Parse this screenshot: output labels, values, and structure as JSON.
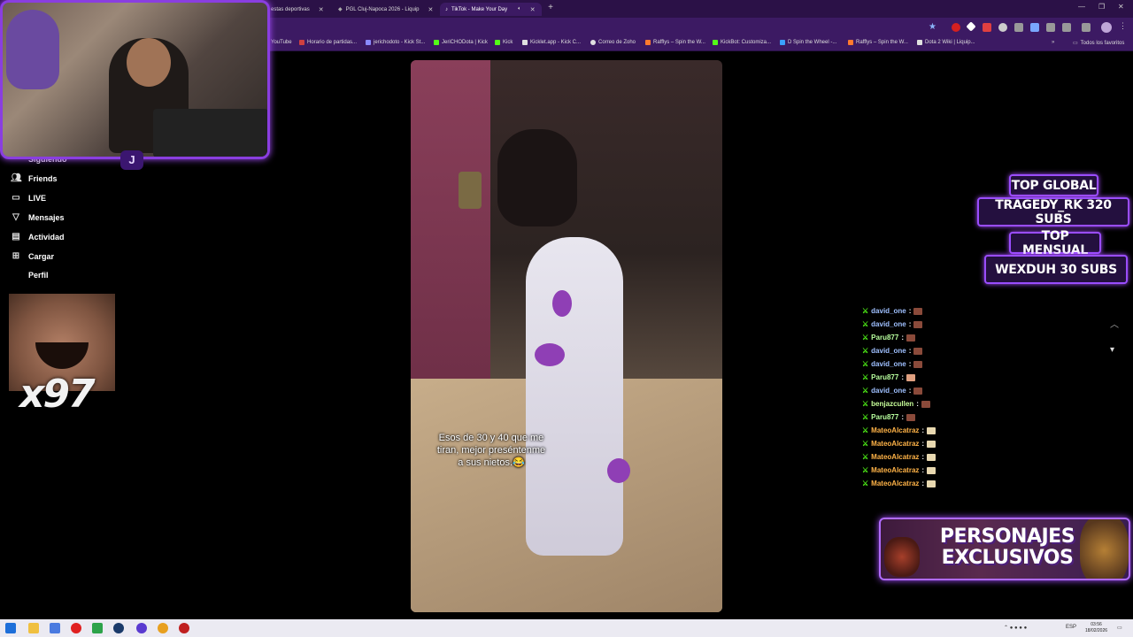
{
  "browser": {
    "tabs": [
      {
        "label": "estas deportivas",
        "active": false
      },
      {
        "label": "PGL Cluj-Napoca 2026 - Liquip",
        "active": false
      },
      {
        "label": "TikTok - Make Your Day",
        "active": true
      }
    ],
    "bookmarks": [
      {
        "label": "YouTube",
        "color": "#ff0000"
      },
      {
        "label": "Horario de partidas...",
        "color": "#d04040"
      },
      {
        "label": "jerichodoto - Kick St...",
        "color": "#8a8aff"
      },
      {
        "label": "JeriCHODota | Kick",
        "color": "#53fc18"
      },
      {
        "label": "Kick",
        "color": "#53fc18"
      },
      {
        "label": "Kicklet.app - Kick C...",
        "color": "#e0e0e0"
      },
      {
        "label": "Correo de Zoho",
        "color": "#e0e0e0"
      },
      {
        "label": "Rafflys – Spin the W...",
        "color": "#ff7a2e"
      },
      {
        "label": "KickBot: Customiza...",
        "color": "#53fc18"
      },
      {
        "label": "D Spin the Wheel -...",
        "color": "#3aa0ff"
      },
      {
        "label": "Rafflys – Spin the W...",
        "color": "#ff7a2e"
      },
      {
        "label": "Dota 2 Wiki | Liquip...",
        "color": "#e0e0e0"
      }
    ],
    "bookmarks_folder": "Todos los favoritos"
  },
  "sidebar": {
    "partial_top": "Siguiendo",
    "items": [
      {
        "label": "Friends",
        "icon": "friends-icon"
      },
      {
        "label": "LIVE",
        "icon": "live-icon"
      },
      {
        "label": "Mensajes",
        "icon": "messages-icon"
      },
      {
        "label": "Actividad",
        "icon": "activity-icon"
      },
      {
        "label": "Cargar",
        "icon": "upload-icon"
      },
      {
        "label": "Perfil",
        "icon": "profile-icon"
      }
    ]
  },
  "emote_overlay": {
    "count": "x97"
  },
  "video": {
    "caption_lines": [
      "Esos de 30 y 40 que me",
      "tiran, mejor preséntenme",
      "a sus nietos.😂"
    ]
  },
  "badges": {
    "top_global_title": "TOP GLOBAL",
    "top_global_value": "TRAGEDY_RK 320 SUBS",
    "top_mensual_title": "TOP MENSUAL",
    "top_mensual_value": "WEXDUH 30 SUBS"
  },
  "chat": [
    {
      "user": "david_one",
      "color": "#9fc0ff"
    },
    {
      "user": "david_one",
      "color": "#9fc0ff"
    },
    {
      "user": "Paru877",
      "color": "#b8ff9e"
    },
    {
      "user": "david_one",
      "color": "#9fc0ff"
    },
    {
      "user": "david_one",
      "color": "#9fc0ff"
    },
    {
      "user": "Paru877",
      "color": "#b8ff9e"
    },
    {
      "user": "david_one",
      "color": "#9fc0ff"
    },
    {
      "user": "benjazcullen",
      "color": "#c8ff9a"
    },
    {
      "user": "Paru877",
      "color": "#b8ff9e"
    },
    {
      "user": "MateoAlcatraz",
      "color": "#ffb347"
    },
    {
      "user": "MateoAlcatraz",
      "color": "#ffb347"
    },
    {
      "user": "MateoAlcatraz",
      "color": "#ffb347"
    },
    {
      "user": "MateoAlcatraz",
      "color": "#ffb347"
    },
    {
      "user": "MateoAlcatraz",
      "color": "#ffb347"
    }
  ],
  "promo": {
    "line1": "PERSONAJES",
    "line2": "EXCLUSIVOS"
  },
  "taskbar": {
    "lang": "ESP",
    "time": "03:56",
    "date": "18/02/2026"
  }
}
